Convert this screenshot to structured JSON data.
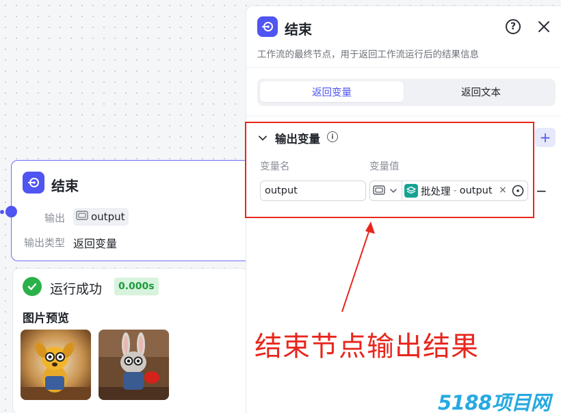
{
  "node": {
    "title": "结束",
    "output_label": "输出",
    "output_tag": "output",
    "output_type_label": "输出类型",
    "output_type_value": "返回变量"
  },
  "run": {
    "status": "运行成功",
    "time": "0.000s",
    "preview_label": "图片预览"
  },
  "panel": {
    "title": "结束",
    "description": "工作流的最终节点，用于返回工作流运行后的结果信息",
    "help_icon": "?",
    "tabs": [
      {
        "label": "返回变量",
        "active": true
      },
      {
        "label": "返回文本",
        "active": false
      }
    ],
    "section": {
      "title": "输出变量",
      "info_icon": "i",
      "add_icon": "+",
      "col_name": "变量名",
      "col_value": "变量值",
      "rows": [
        {
          "name": "output",
          "ref_node": "批处理",
          "ref_sep": "-",
          "ref_var": "output",
          "clear_icon": "×",
          "remove_icon": "−"
        }
      ]
    }
  },
  "annotation": {
    "text": "结束节点输出结果",
    "color": "#e8261d"
  },
  "watermark": "5188项目网",
  "colors": {
    "accent": "#4f55f0",
    "success": "#2bb14a",
    "ref_icon": "#16a394"
  }
}
